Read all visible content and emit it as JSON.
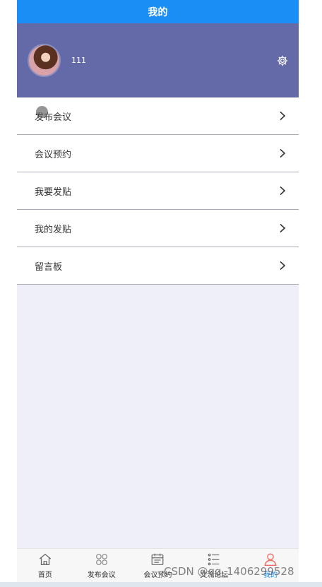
{
  "header": {
    "title": "我的"
  },
  "profile": {
    "username": "111"
  },
  "menu": {
    "items": [
      {
        "label": "发布会议"
      },
      {
        "label": "会议预约"
      },
      {
        "label": "我要发贴"
      },
      {
        "label": "我的发贴"
      },
      {
        "label": "留言板"
      }
    ]
  },
  "tabbar": {
    "tabs": [
      {
        "label": "首页",
        "icon": "home-icon"
      },
      {
        "label": "发布会议",
        "icon": "grid-icon"
      },
      {
        "label": "会议预约",
        "icon": "calendar-icon"
      },
      {
        "label": "交流论坛",
        "icon": "list-icon"
      },
      {
        "label": "我的",
        "icon": "user-icon"
      }
    ],
    "active_color": "#1b8ef5"
  },
  "watermark": "CSDN @qq_1406299528"
}
